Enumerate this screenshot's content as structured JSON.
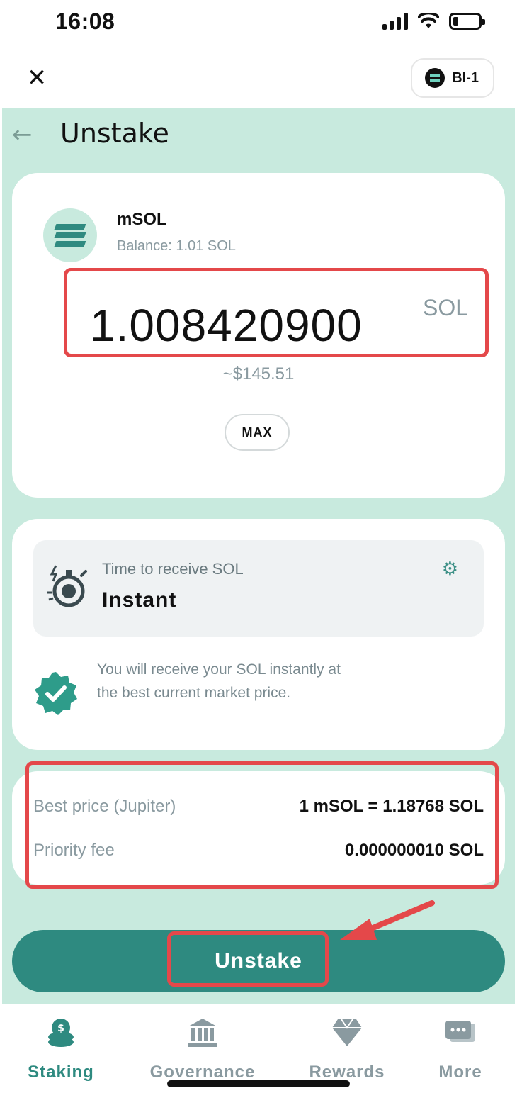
{
  "status_bar": {
    "time": "16:08"
  },
  "header": {
    "close_label": "✕",
    "wallet_name": "BI-1"
  },
  "page": {
    "title": "Unstake",
    "back_label": "←"
  },
  "amount_card": {
    "token_name": "mSOL",
    "balance_label": "Balance: 1.01 SOL",
    "amount": "1.008420900",
    "unit": "SOL",
    "usd_value": "~$145.51",
    "max_label": "MAX"
  },
  "speed_card": {
    "label": "Time to receive SOL",
    "value": "Instant",
    "info_text": "You will receive your SOL instantly at the best current market price."
  },
  "details": {
    "rows": [
      {
        "label": "Best price (Jupiter)",
        "value": "1 mSOL = 1.18768 SOL"
      },
      {
        "label": "Priority fee",
        "value": "0.000000010 SOL"
      }
    ]
  },
  "action": {
    "unstake_label": "Unstake"
  },
  "bottom_nav": [
    {
      "label": "Staking",
      "active": true
    },
    {
      "label": "Governance",
      "active": false
    },
    {
      "label": "Rewards",
      "active": false
    },
    {
      "label": "More",
      "active": false
    }
  ],
  "colors": {
    "accent": "#2e8a80",
    "background": "#c8eade",
    "highlight": "#e4484a",
    "muted_text": "#8a9aa0"
  }
}
